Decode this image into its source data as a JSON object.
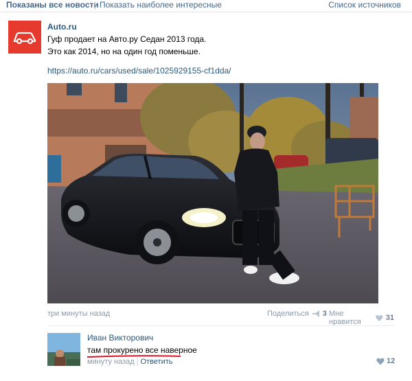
{
  "header": {
    "active_tab": "Показаны все новости",
    "separator": "|",
    "tab_interesting": "Показать наиболее интересные",
    "sources_link": "Список источников"
  },
  "post": {
    "author": "Auto.ru",
    "text_line1": "Гуф продает на Авто.ру Седан 2013 года.",
    "text_line2": "Это как 2014, но на один год поменьше.",
    "link": "https://auto.ru/cars/used/sale/1025929155-cf1dda/",
    "time": "три минуты назад",
    "share_label": "Поделиться",
    "share_count": "3",
    "like_label": "Мне нравится",
    "like_count": "31",
    "brand_color": "#e63a2e"
  },
  "comment": {
    "author": "Иван Викторович",
    "text": "там прокурено все наверное",
    "time": "минуту назад",
    "reply_label": "Ответить",
    "like_count": "12",
    "underline_color": "#d4142a"
  }
}
